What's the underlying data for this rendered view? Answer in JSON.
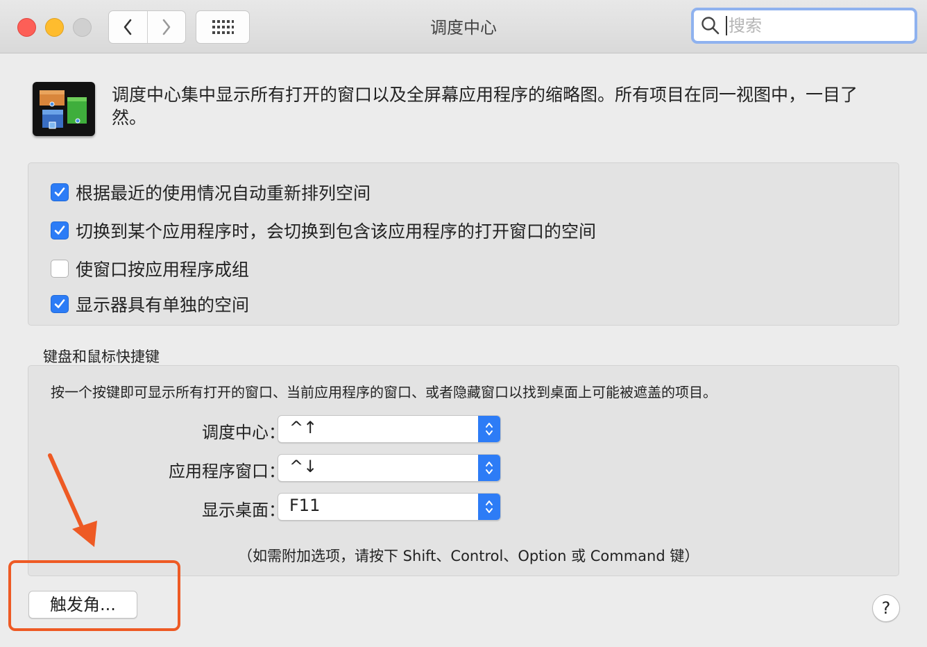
{
  "window": {
    "title": "调度中心",
    "search_placeholder": "搜索"
  },
  "header": {
    "description": "调度中心集中显示所有打开的窗口以及全屏幕应用程序的缩略图。所有项目在同一视图中，一目了然。"
  },
  "options": [
    {
      "label": "根据最近的使用情况自动重新排列空间",
      "checked": true
    },
    {
      "label": "切换到某个应用程序时，会切换到包含该应用程序的打开窗口的空间",
      "checked": true
    },
    {
      "label": "使窗口按应用程序成组",
      "checked": false
    },
    {
      "label": "显示器具有单独的空间",
      "checked": true
    }
  ],
  "shortcuts": {
    "section_title": "键盘和鼠标快捷键",
    "hint": "按一个按键即可显示所有打开的窗口、当前应用程序的窗口、或者隐藏窗口以找到桌面上可能被遮盖的项目。",
    "rows": [
      {
        "label": "调度中心：",
        "value": "^↑"
      },
      {
        "label": "应用程序窗口：",
        "value": "^↓"
      },
      {
        "label": "显示桌面：",
        "value": "F11"
      }
    ],
    "footnote": "（如需附加选项，请按下 Shift、Control、Option 或 Command 键）"
  },
  "footer": {
    "hot_corners_label": "触发角...",
    "help_label": "?"
  },
  "colors": {
    "accent": "#2c7cf6",
    "annotation": "#ee5a24"
  }
}
